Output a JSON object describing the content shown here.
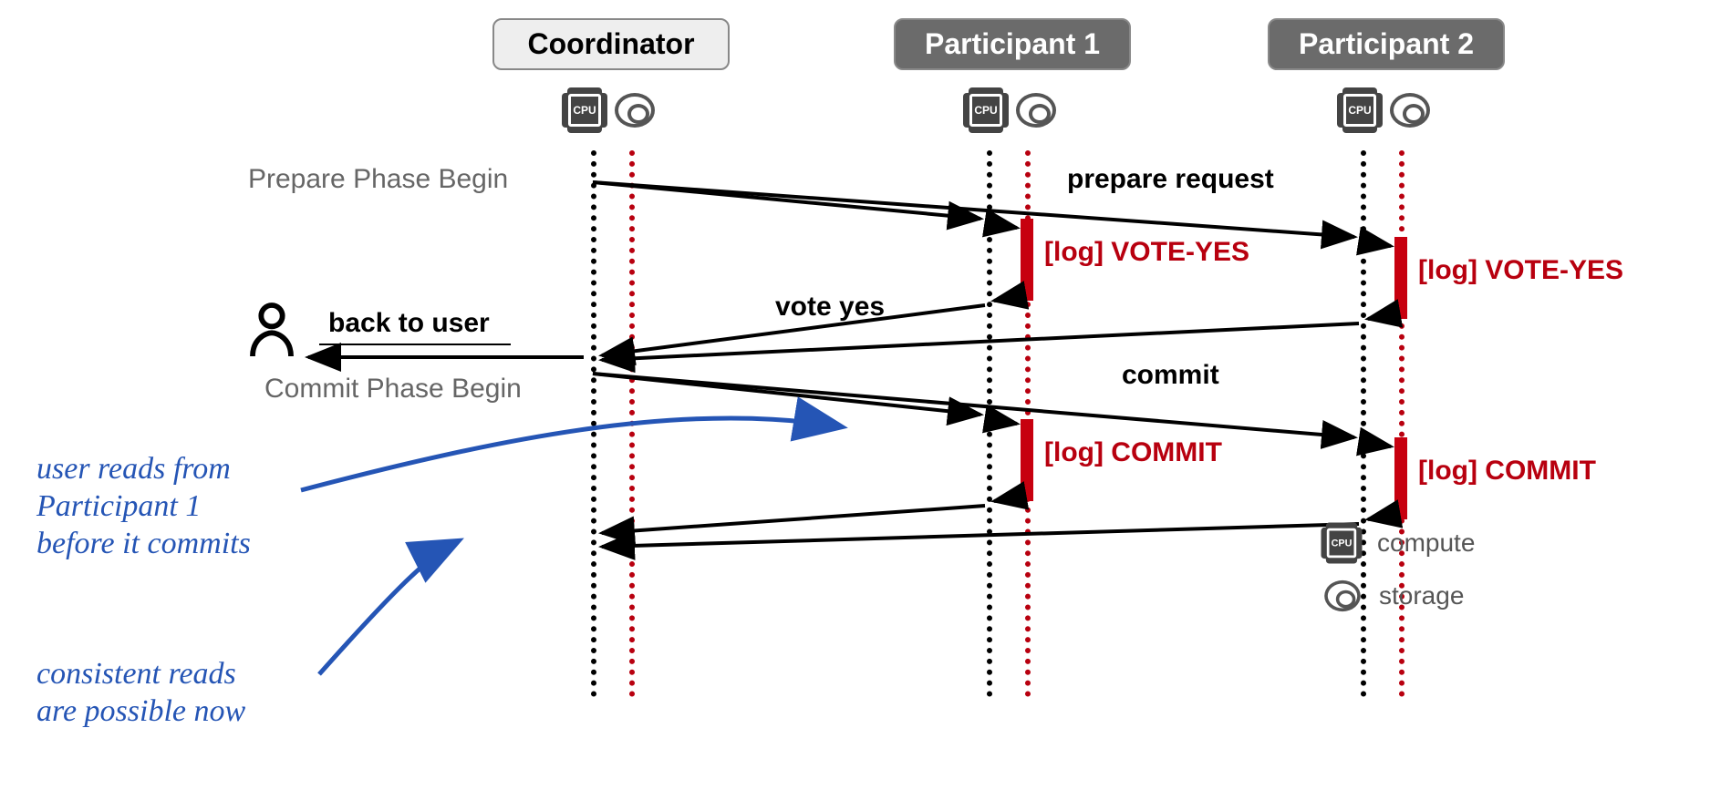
{
  "roles": {
    "coordinator": "Coordinator",
    "participant1": "Participant 1",
    "participant2": "Participant 2"
  },
  "phases": {
    "prepare": "Prepare Phase Begin",
    "commit": "Commit Phase Begin"
  },
  "messages": {
    "prepare_request": "prepare request",
    "vote_yes": "vote yes",
    "commit": "commit",
    "back_to_user": "back to user"
  },
  "log_entries": {
    "vote_yes_p1": "[log] VOTE-YES",
    "vote_yes_p2": "[log] VOTE-YES",
    "commit_p1": "[log] COMMIT",
    "commit_p2": "[log] COMMIT"
  },
  "handwriting": {
    "note1_line1": "user reads from",
    "note1_line2": "Participant 1",
    "note1_line3": "before it commits",
    "note2_line1": "consistent reads",
    "note2_line2": "are possible now"
  },
  "legend": {
    "compute": "compute",
    "storage": "storage"
  },
  "icon_label": {
    "cpu": "CPU"
  }
}
